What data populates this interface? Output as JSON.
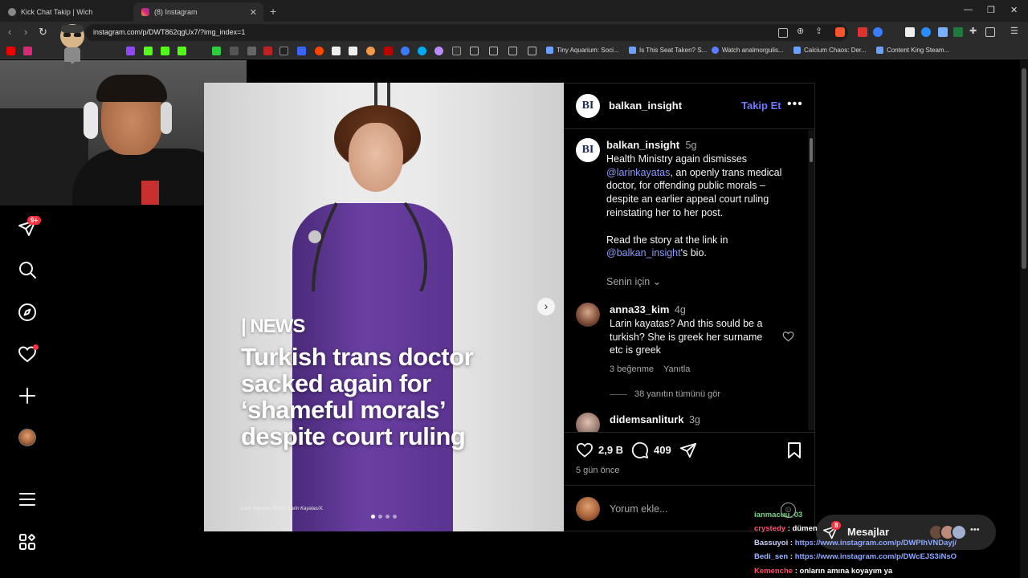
{
  "browser": {
    "tabs": [
      {
        "label": "Kick Chat Takip | Wich",
        "active": false
      },
      {
        "label": "(8) Instagram",
        "active": true
      }
    ],
    "url": "instagram.com/p/DWT862qgUx7/?img_index=1",
    "bookmarks": [
      "Tiny Aquarium: Soci...",
      "Is This Seat Taken? S...",
      "Watch analmorgulis...",
      "Calcium Chaos: Der...",
      "Content King Steam..."
    ]
  },
  "sidenav": {
    "notification_badge": "9+",
    "icons": [
      "direct-icon",
      "search-icon",
      "explore-icon",
      "heart-icon",
      "create-icon",
      "profile-icon",
      "menu-icon",
      "more-apps-icon"
    ]
  },
  "post": {
    "image": {
      "news_tag": "NEWS",
      "headline": "Turkish trans doctor sacked again for ‘shameful morals’ despite court ruling",
      "credit": "Larin Kayatas. Photo: Larin Kayatas/X."
    },
    "header": {
      "username": "balkan_insight",
      "follow_label": "Takip Et",
      "logo_text": "BI"
    },
    "caption": {
      "username": "balkan_insight",
      "time": "5g",
      "text_1": "Health Ministry again dismisses",
      "mention_1": "@larinkayatas",
      "text_2": ", an openly trans medical doctor, for offending public morals – despite an earlier appeal court ruling reinstating her to her post.",
      "text_3": "Read the story at the link in",
      "mention_2": "@balkan_insight",
      "text_4": "'s bio."
    },
    "for_you": "Senin için",
    "comments": [
      {
        "username": "anna33_kim",
        "time": "4g",
        "text": "Larin kayatas? And this sould be a turkish? She is greek her surname etc is greek",
        "likes": "3 beğenme",
        "reply": "Yanıtla",
        "view_replies": "38 yanıtın tümünü gör"
      },
      {
        "username": "didemsanliturk",
        "time": "3g"
      }
    ],
    "actions": {
      "likes": "2,9 B",
      "comments": "409"
    },
    "posted": "5 gün önce",
    "comment_placeholder": "Yorum ekle..."
  },
  "messages": {
    "label": "Mesajlar",
    "badge": "8"
  },
  "chat_overlay": [
    {
      "user": "ianmacuu_03",
      "text": "",
      "color": "#7cd38a"
    },
    {
      "user": "crystedy",
      "text": "dümen",
      "color": "#ff4d6d"
    },
    {
      "user": "Bassuyoi",
      "text": "https://www.instagram.com/p/DWPIhVNDayj/",
      "color": "#d0d0ff"
    },
    {
      "user": "Bedi_sen",
      "text": "https://www.instagram.com/p/DWcEJS3iNsO",
      "color": "#9fb4ff"
    },
    {
      "user": "Kemenche",
      "text": "onların amına koyayım ya",
      "color": "#ff4d6d"
    }
  ]
}
